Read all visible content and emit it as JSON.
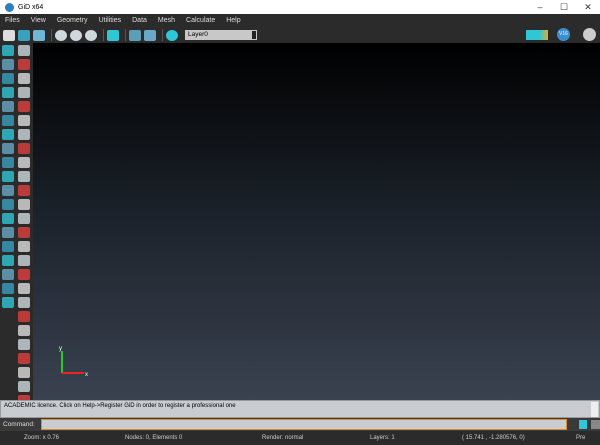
{
  "window": {
    "title": "GiD x64",
    "minimize": "–",
    "maximize": "☐",
    "close": "✕"
  },
  "menu": [
    "Files",
    "View",
    "Geometry",
    "Utilities",
    "Data",
    "Mesh",
    "Calculate",
    "Help"
  ],
  "toolbar": {
    "layer": "Layer0",
    "version_badge": "V16"
  },
  "axes": {
    "x": "x",
    "y": "y"
  },
  "message": "ACADEMIC licence. Click on Help->Register GiD in order to register a professional one",
  "command": {
    "label": "Command:",
    "value": ""
  },
  "status": {
    "zoom": "Zoom: x 0.76",
    "nodes": "Nodes: 0, Elements 0",
    "render": "Render: normal",
    "layers": "Layers: 1",
    "coords": "( 15.741 , -1.280576, 0)",
    "pre": "Pre"
  },
  "colors": {
    "accent": "#2fc6d6",
    "cmd_border": "#e08a2a"
  }
}
